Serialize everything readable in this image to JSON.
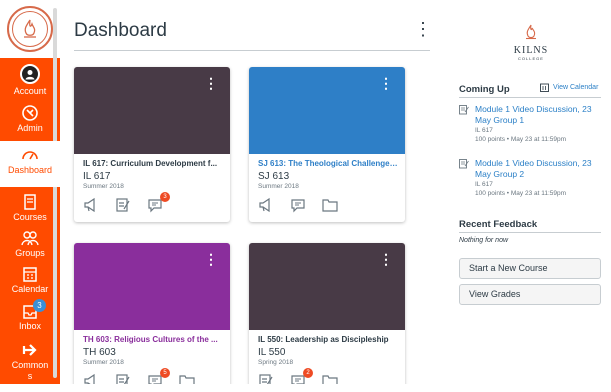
{
  "institution": {
    "logo_name": "KILNS",
    "logo_sub": "COLLEGE",
    "seal_text": "KILNS COLLEGE"
  },
  "global_nav": [
    {
      "label": "Account",
      "icon": "account-avatar-icon"
    },
    {
      "label": "Admin",
      "icon": "shield-icon"
    },
    {
      "label": "Dashboard",
      "icon": "dashboard-icon",
      "active": true
    },
    {
      "label": "Courses",
      "icon": "book-icon"
    },
    {
      "label": "Groups",
      "icon": "groups-icon"
    },
    {
      "label": "Calendar",
      "icon": "calendar-icon"
    },
    {
      "label": "Inbox",
      "icon": "inbox-icon",
      "badge": "3"
    },
    {
      "label": "Commons",
      "icon": "commons-arrow-icon"
    }
  ],
  "header": {
    "title": "Dashboard",
    "options_glyph": "⋮"
  },
  "cards": [
    {
      "title": "IL 617: Curriculum Development f...",
      "code": "IL 617",
      "term": "Summer 2018",
      "color": "#483a46",
      "title_color": "#2d3b45",
      "discussion_badge": "3",
      "show_files": false
    },
    {
      "title": "SJ 613: The Theological Challenge ...",
      "code": "SJ 613",
      "term": "Summer 2018",
      "color": "#2e7fc7",
      "title_color": "#2e7fc7",
      "discussion_badge": "",
      "show_files": true
    },
    {
      "title": "TH 603: Religious Cultures of the ...",
      "code": "TH 603",
      "term": "Summer 2018",
      "color": "#8a2e9c",
      "title_color": "#8a2e9c",
      "discussion_badge": "5",
      "show_files": true
    },
    {
      "title": "IL 550: Leadership as Discipleship",
      "code": "IL 550",
      "term": "Spring 2018",
      "color": "#483a46",
      "title_color": "#2d3b45",
      "discussion_badge": "2",
      "show_files": true
    }
  ],
  "sidebar": {
    "coming_up": {
      "heading": "Coming Up",
      "calendar_link": "View Calendar",
      "items": [
        {
          "title": "Module 1 Video Discussion, 23 May Group 1",
          "course": "IL 617",
          "meta": "100 points • May 23 at 11:59pm"
        },
        {
          "title": "Module 1 Video Discussion, 23 May Group 2",
          "course": "IL 617",
          "meta": "100 points • May 23 at 11:59pm"
        }
      ]
    },
    "recent_feedback": {
      "heading": "Recent Feedback",
      "empty": "Nothing for now"
    },
    "buttons": {
      "new_course": "Start a New Course",
      "grades": "View Grades"
    }
  },
  "colors": {
    "nav_bg": "#ff4b00",
    "link": "#2c80c7",
    "badge_red": "#ee4b24",
    "badge_blue": "#3b8fd6"
  }
}
